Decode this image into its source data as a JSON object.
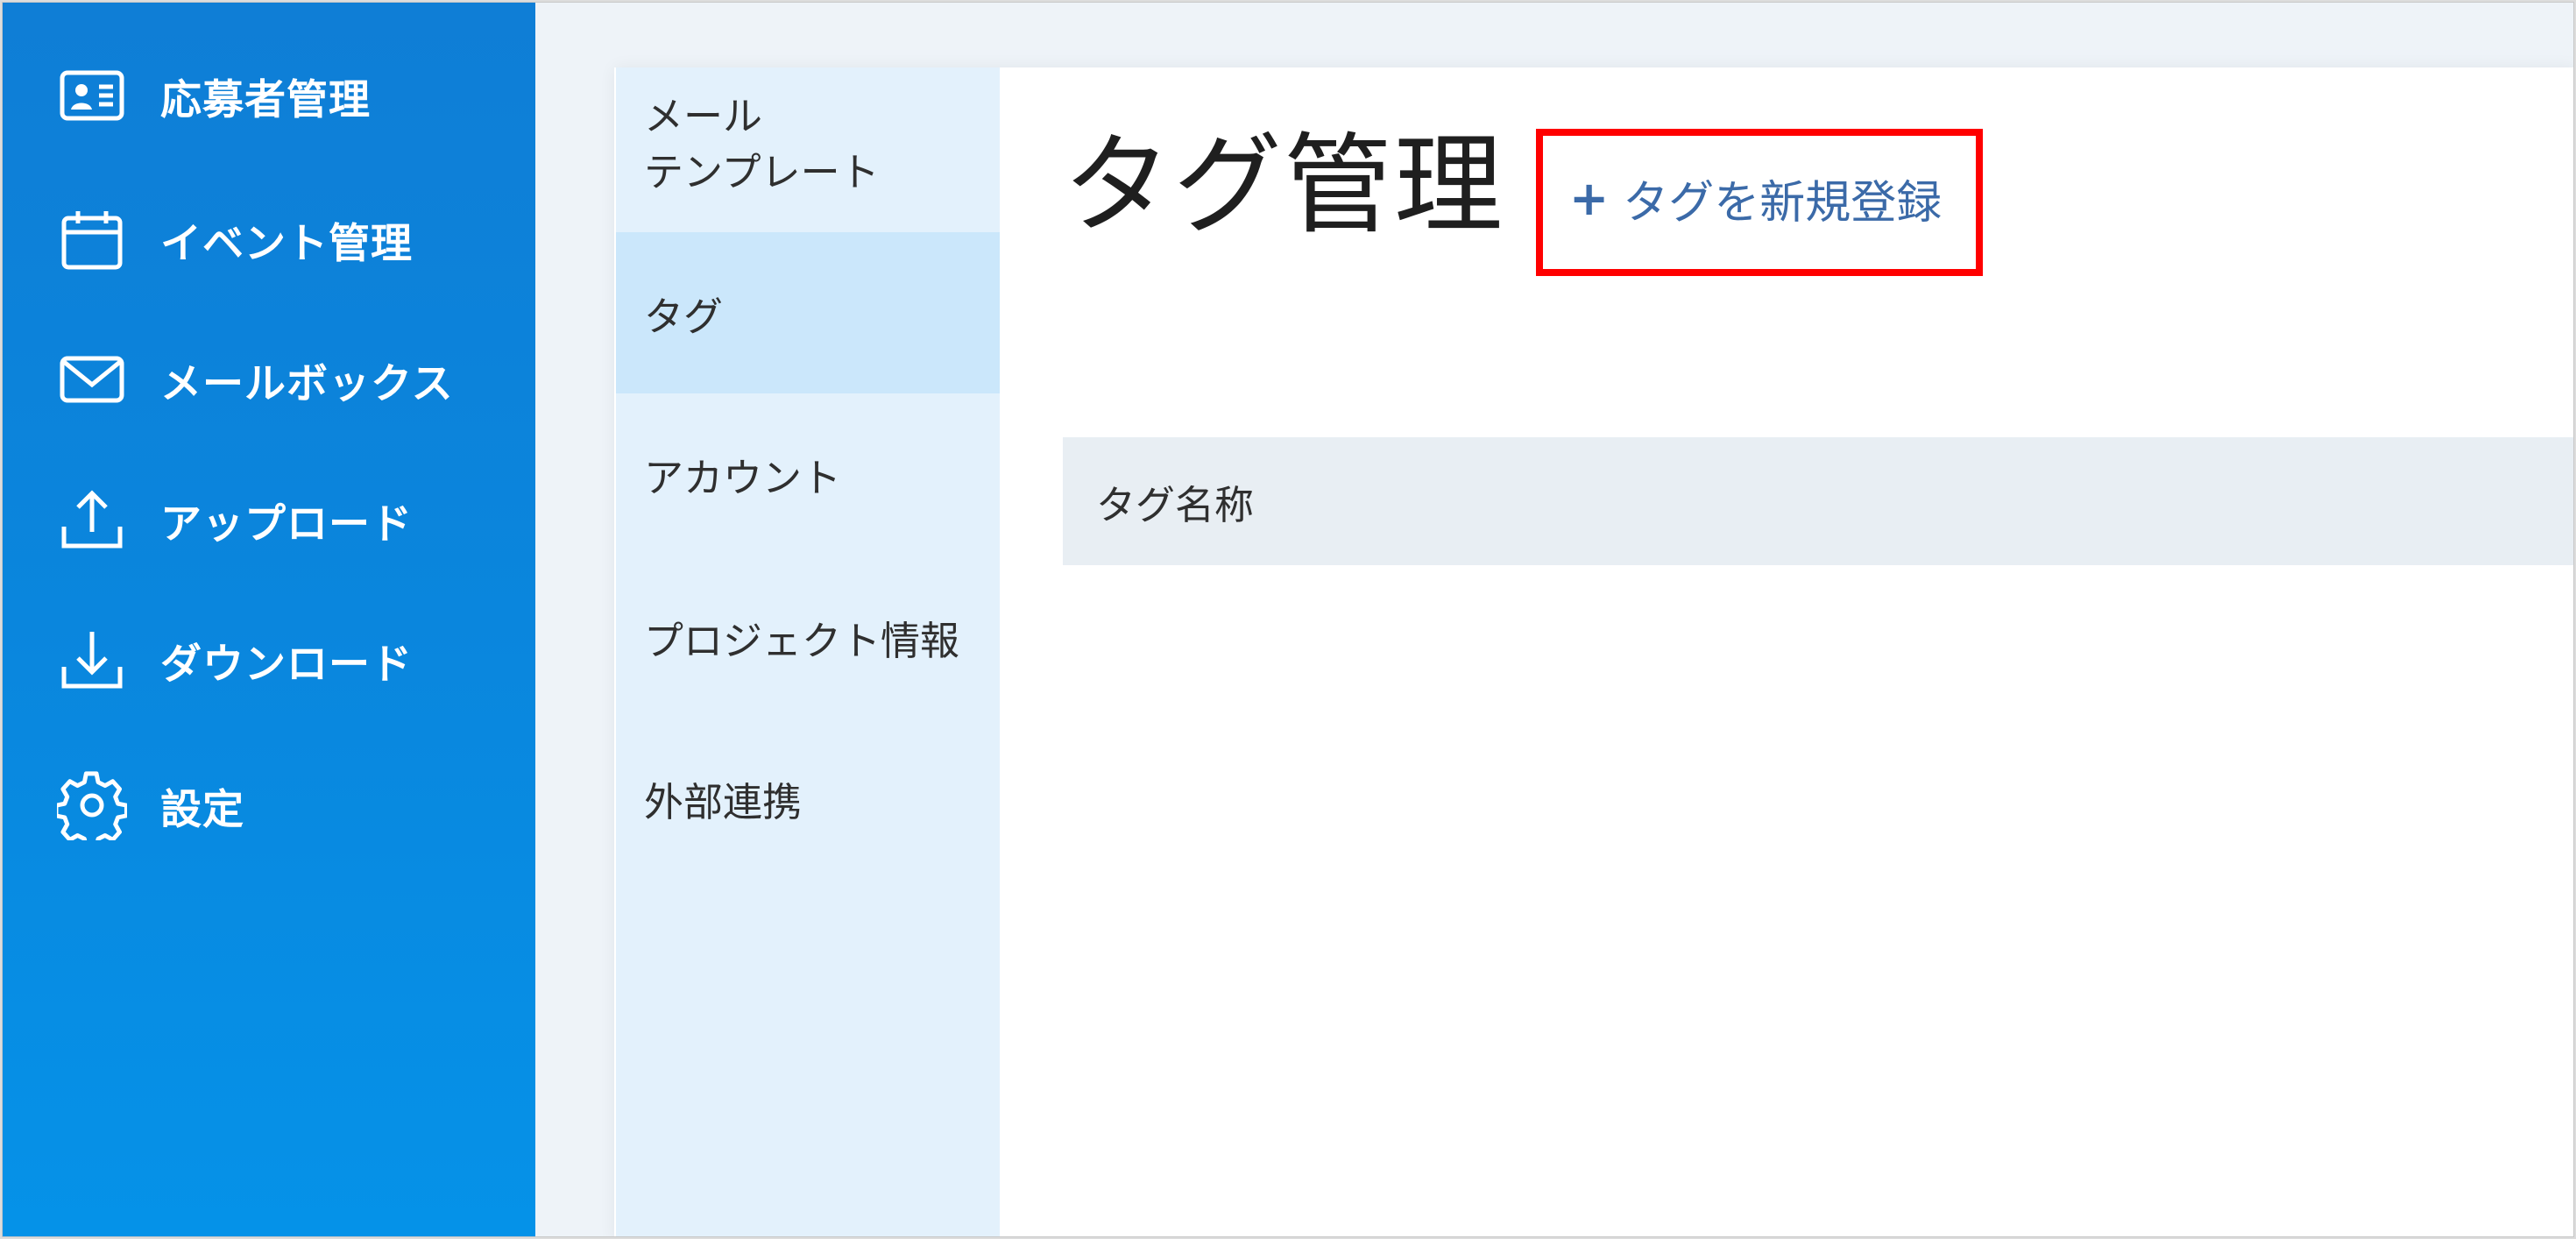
{
  "sidebar": {
    "items": [
      {
        "label": "応募者管理",
        "icon": "applicant-card-icon"
      },
      {
        "label": "イベント管理",
        "icon": "calendar-icon"
      },
      {
        "label": "メールボックス",
        "icon": "mail-icon"
      },
      {
        "label": "アップロード",
        "icon": "upload-icon"
      },
      {
        "label": "ダウンロード",
        "icon": "download-icon"
      },
      {
        "label": "設定",
        "icon": "gear-icon"
      }
    ]
  },
  "subnav": {
    "items": [
      {
        "label_line1": "メール",
        "label_line2": "テンプレート"
      },
      {
        "label": "タグ",
        "active": true
      },
      {
        "label": "アカウント"
      },
      {
        "label": "プロジェクト情報"
      },
      {
        "label": "外部連携"
      }
    ]
  },
  "main": {
    "title": "タグ管理",
    "add_button": {
      "plus": "+",
      "label": "タグを新規登録"
    },
    "table": {
      "columns": [
        "タグ名称"
      ]
    }
  },
  "colors": {
    "sidebar": "#0a86dd",
    "subnav": "#e3f1fc",
    "subnav_active": "#cbe7fb",
    "highlight": "#ff0000",
    "link": "#3b6aa8"
  }
}
